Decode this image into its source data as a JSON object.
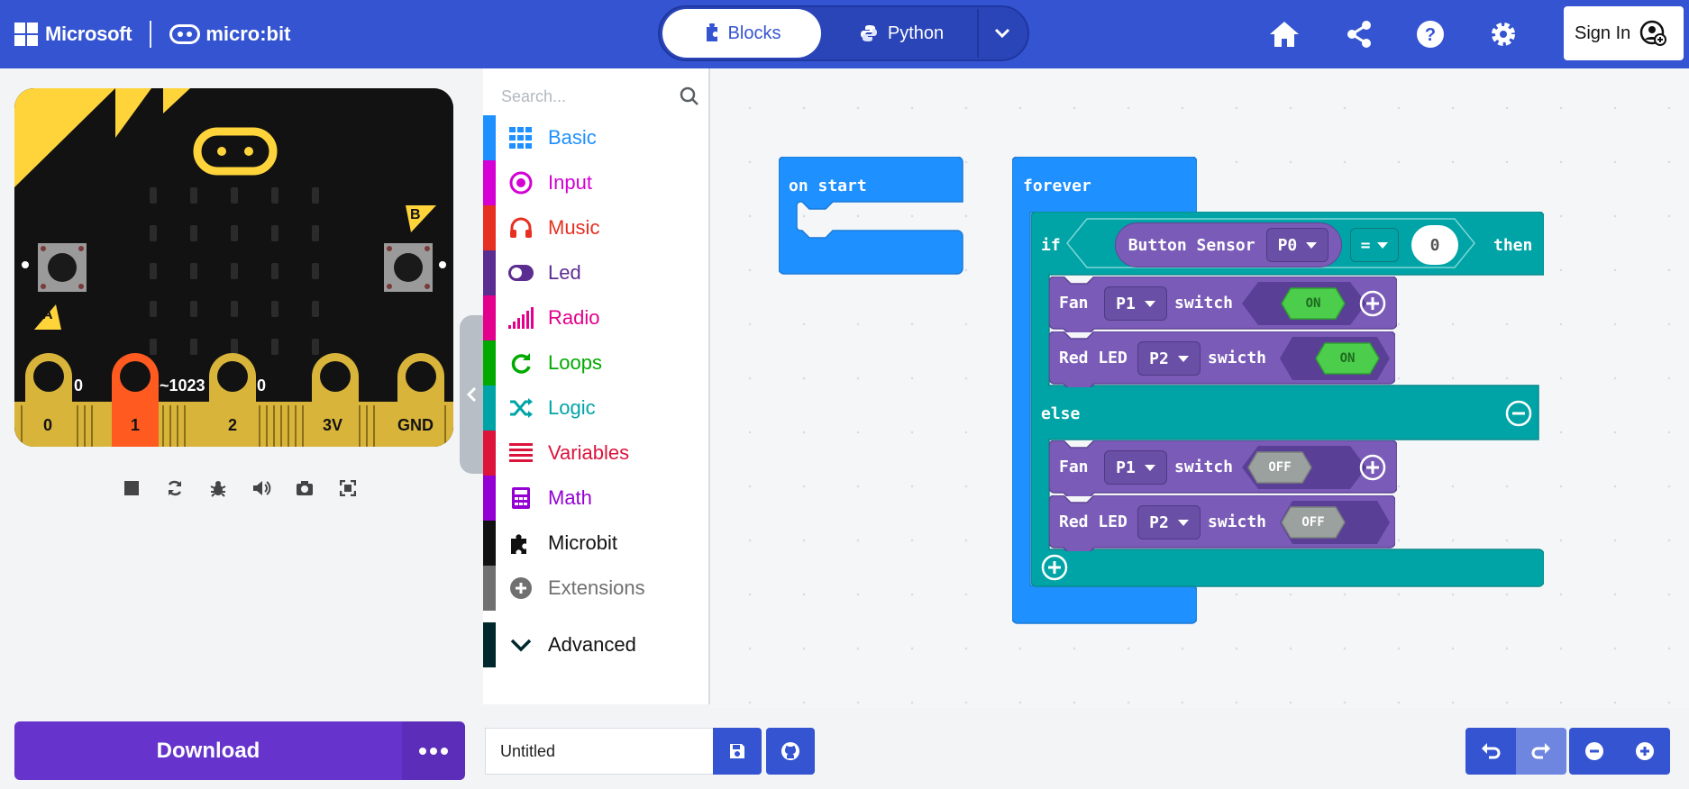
{
  "header": {
    "brand_ms": "Microsoft",
    "brand_mb": "micro:bit",
    "mode_blocks": "Blocks",
    "mode_python": "Python",
    "signin": "Sign In"
  },
  "search": {
    "placeholder": "Search..."
  },
  "categories": [
    {
      "label": "Basic",
      "color": "#1e90ff",
      "icon": "grid-icon"
    },
    {
      "label": "Input",
      "color": "#d400d4",
      "icon": "target-icon"
    },
    {
      "label": "Music",
      "color": "#e63022",
      "icon": "headphones-icon"
    },
    {
      "label": "Led",
      "color": "#5c2d91",
      "icon": "toggle-icon"
    },
    {
      "label": "Radio",
      "color": "#e3008c",
      "icon": "signal-icon"
    },
    {
      "label": "Loops",
      "color": "#00aa00",
      "icon": "refresh-icon"
    },
    {
      "label": "Logic",
      "color": "#00a4a6",
      "icon": "shuffle-icon"
    },
    {
      "label": "Variables",
      "color": "#dc143c",
      "icon": "list-icon"
    },
    {
      "label": "Math",
      "color": "#9400d3",
      "icon": "calculator-icon"
    },
    {
      "label": "Microbit",
      "color": "#111111",
      "icon": "puzzle-icon"
    },
    {
      "label": "Extensions",
      "color": "#707070",
      "icon": "plus-circle-icon"
    },
    {
      "label": "Advanced",
      "color": "#00272b",
      "icon": "chevron-down-icon"
    }
  ],
  "board": {
    "pins": [
      "0",
      "1",
      "2",
      "3V",
      "GND"
    ],
    "pin_values": [
      "0",
      "~1023",
      "0"
    ],
    "btn_a": "A",
    "btn_b": "B"
  },
  "blocks": {
    "on_start": "on start",
    "forever": "forever",
    "if": "if",
    "button_sensor": "Button Sensor",
    "p0": "P0",
    "eq": "=",
    "zero": "0",
    "then": "then",
    "else": "else",
    "fan": "Fan",
    "red_led": "Red LED",
    "p1": "P1",
    "p2": "P2",
    "switch": "switch",
    "swicth": "swicth",
    "on": "ON",
    "off": "OFF"
  },
  "bottom": {
    "download": "Download",
    "project_name": "Untitled"
  }
}
